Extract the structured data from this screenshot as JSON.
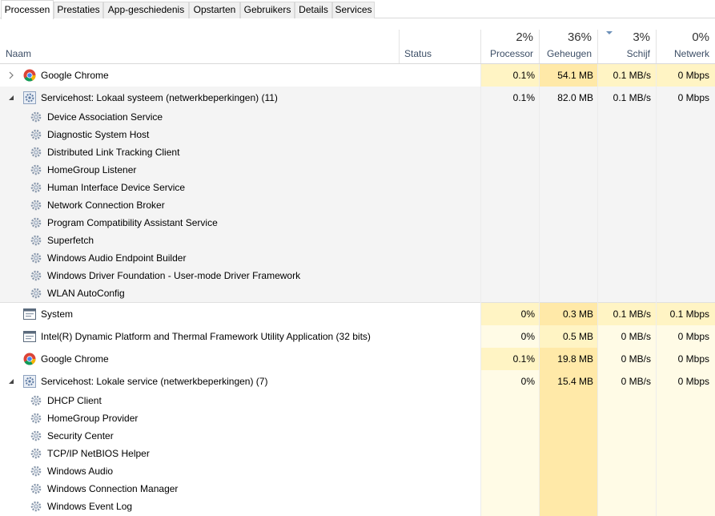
{
  "tabs": [
    "Processen",
    "Prestaties",
    "App-geschiedenis",
    "Opstarten",
    "Gebruikers",
    "Details",
    "Services"
  ],
  "columns": {
    "name": "Naam",
    "status": "Status",
    "processor": {
      "pct": "2%",
      "label": "Processor"
    },
    "memory": {
      "pct": "36%",
      "label": "Geheugen"
    },
    "disk": {
      "pct": "3%",
      "label": "Schijf"
    },
    "network": {
      "pct": "0%",
      "label": "Netwerk"
    }
  },
  "rows": [
    {
      "name": "Google Chrome",
      "icon": "chrome-icon",
      "proc": "0.1%",
      "mem": "54.1 MB",
      "disk": "0.1 MB/s",
      "net": "0 Mbps"
    },
    {
      "name": "Servicehost: Lokaal systeem (netwerkbeperkingen) (11)",
      "icon": "gear-icon",
      "proc": "0.1%",
      "mem": "82.0 MB",
      "disk": "0.1 MB/s",
      "net": "0 Mbps",
      "children": [
        "Device Association Service",
        "Diagnostic System Host",
        "Distributed Link Tracking Client",
        "HomeGroup Listener",
        "Human Interface Device Service",
        "Network Connection Broker",
        "Program Compatibility Assistant Service",
        "Superfetch",
        "Windows Audio Endpoint Builder",
        "Windows Driver Foundation - User-mode Driver Framework",
        "WLAN AutoConfig"
      ]
    },
    {
      "name": "System",
      "icon": "window-icon",
      "proc": "0%",
      "mem": "0.3 MB",
      "disk": "0.1 MB/s",
      "net": "0.1 Mbps"
    },
    {
      "name": "Intel(R) Dynamic Platform and Thermal Framework Utility Application (32 bits)",
      "icon": "window-icon",
      "proc": "0%",
      "mem": "0.5 MB",
      "disk": "0 MB/s",
      "net": "0 Mbps"
    },
    {
      "name": "Google Chrome",
      "icon": "chrome-icon",
      "proc": "0.1%",
      "mem": "19.8 MB",
      "disk": "0 MB/s",
      "net": "0 Mbps"
    },
    {
      "name": "Servicehost: Lokale service (netwerkbeperkingen) (7)",
      "icon": "gear-icon",
      "proc": "0%",
      "mem": "15.4 MB",
      "disk": "0 MB/s",
      "net": "0 Mbps",
      "children": [
        "DHCP Client",
        "HomeGroup Provider",
        "Security Center",
        "TCP/IP NetBIOS Helper",
        "Windows Audio",
        "Windows Connection Manager",
        "Windows Event Log"
      ]
    }
  ]
}
